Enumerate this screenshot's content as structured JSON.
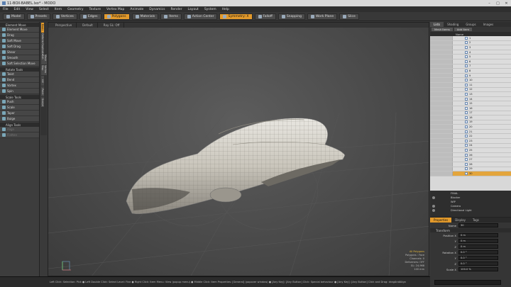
{
  "window": {
    "title": "11-BOX-BABEL.lxo* - MODO"
  },
  "menu": [
    "File",
    "Edit",
    "View",
    "Select",
    "Item",
    "Geometry",
    "Texture",
    "Vertex Map",
    "Animate",
    "Dynamics",
    "Render",
    "Layout",
    "System",
    "Help"
  ],
  "toolbar": [
    {
      "label": "Model",
      "active": false
    },
    {
      "label": "Presets",
      "active": false
    },
    {
      "label": "Vertices",
      "active": false
    },
    {
      "label": "Edges",
      "active": false
    },
    {
      "label": "Polygons",
      "active": true
    },
    {
      "label": "Materials",
      "active": false
    },
    {
      "label": "Items",
      "active": false
    },
    {
      "label": "Action Center",
      "active": false
    },
    {
      "label": "Symmetry: X",
      "active": true
    },
    {
      "label": "Falloff",
      "active": false
    },
    {
      "label": "Snapping",
      "active": false
    },
    {
      "label": "Work Plane",
      "active": false
    },
    {
      "label": "Slice",
      "active": false
    }
  ],
  "left_panel": {
    "tabs": [
      "Basic",
      "Deform",
      "Duplicate",
      "Mesh Edit",
      "Vertex Map",
      "UV",
      "Paint",
      "Sculpt"
    ],
    "sections": [
      {
        "title": "Element Move",
        "items": []
      },
      {
        "title": "",
        "items": [
          "Element Move",
          "Drag",
          "Soft Move",
          "Soft Drag",
          "Shear",
          "Smooth",
          "Soft Selection Move"
        ]
      },
      {
        "title": "Rotate Tools",
        "items": [
          "Twist",
          "Bend",
          "Vortex",
          "Spin"
        ]
      },
      {
        "title": "Scale Tools",
        "items": [
          "Push",
          "Scale",
          "Taper",
          "Bulge"
        ]
      },
      {
        "title": "Align Tools",
        "items": [
          "Align",
          "Flatten"
        ]
      }
    ]
  },
  "viewport": {
    "tabs": [
      "Perspective",
      "Default",
      "Ray GL: Off"
    ],
    "info": {
      "header": "All Polygons",
      "lines": [
        "Polygons : Face",
        "Channels: 0",
        "Deformers: OFF",
        "GL: 24,968",
        "100 mm"
      ]
    }
  },
  "right_panel": {
    "tabs": [
      "Lists",
      "Shading",
      "Groups",
      "Images"
    ],
    "buttons": [
      "Mesh Items",
      "Add Item"
    ],
    "column_name": "Name",
    "items": [
      "1",
      "2",
      "3",
      "4",
      "5",
      "6",
      "7",
      "8",
      "9",
      "10",
      "11",
      "12",
      "13",
      "14",
      "15",
      "16",
      "17",
      "18",
      "19",
      "20",
      "21",
      "22",
      "23",
      "24",
      "25",
      "26",
      "27",
      "28",
      "29",
      "30"
    ],
    "selected_index": 29,
    "scene": [
      {
        "name": "FINAL",
        "eye": false
      },
      {
        "name": "Blocker",
        "eye": true
      },
      {
        "name": "WIP",
        "eye": false
      },
      {
        "name": "Camera",
        "eye": true
      },
      {
        "name": "Directional Light",
        "eye": true
      }
    ]
  },
  "properties": {
    "tabs": [
      "Properties",
      "Display",
      "Tags"
    ],
    "name_label": "Name",
    "name_value": "30",
    "group": "Transform",
    "rows": [
      {
        "label": "Position X",
        "value": "0 m"
      },
      {
        "label": "Y",
        "value": "0 m"
      },
      {
        "label": "Z",
        "value": "0 m"
      },
      {
        "label": "Rotation X",
        "value": "0.0 °"
      },
      {
        "label": "Y",
        "value": "0.0 °"
      },
      {
        "label": "Z",
        "value": "0.0 °"
      },
      {
        "label": "Scale X",
        "value": "100.0 %"
      }
    ]
  },
  "status": "Left Click: Selection: Pick  ●  Left Double Click: Select Level: Fine  ●  Right Click: Item Menu: View (popup menu)  ●  Middle Click: Item Properties: [General] (popover window)  ●  [Any Key]: [Any Button] Click: Special behaviour  ●  [Any Key]: [Any Button] Click and Drag: dragAndAlign",
  "colors": {
    "accent": "#e39a2b",
    "selection": "#e3a53c"
  }
}
